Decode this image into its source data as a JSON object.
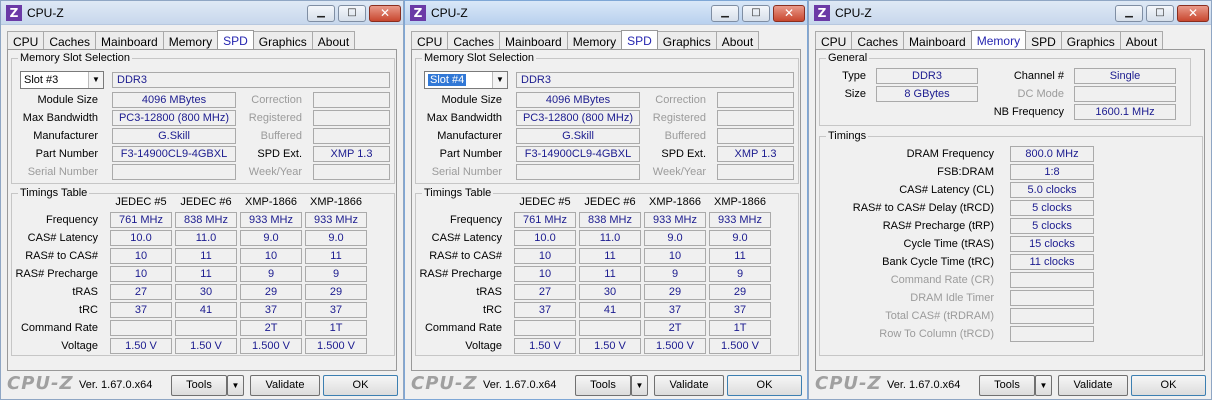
{
  "app": {
    "title": "CPU-Z",
    "icon": "Z"
  },
  "tabs": [
    "CPU",
    "Caches",
    "Mainboard",
    "Memory",
    "SPD",
    "Graphics",
    "About"
  ],
  "footer": {
    "logo": "CPU-Z",
    "version": "Ver. 1.67.0.x64",
    "tools": "Tools",
    "tools_arrow": "▼",
    "validate": "Validate",
    "ok": "OK"
  },
  "spd_labels": {
    "group_slot": "Memory Slot Selection",
    "module_size": "Module Size",
    "max_bandwidth": "Max Bandwidth",
    "manufacturer": "Manufacturer",
    "part_number": "Part Number",
    "serial_number": "Serial Number",
    "correction": "Correction",
    "registered": "Registered",
    "buffered": "Buffered",
    "spd_ext": "SPD Ext.",
    "week_year": "Week/Year",
    "group_timings": "Timings Table",
    "rows": [
      "Frequency",
      "CAS# Latency",
      "RAS# to CAS#",
      "RAS# Precharge",
      "tRAS",
      "tRC",
      "Command Rate",
      "Voltage"
    ],
    "cols": [
      "JEDEC #5",
      "JEDEC #6",
      "XMP-1866",
      "XMP-1866"
    ]
  },
  "window1": {
    "slot": "Slot #3",
    "type": "DDR3",
    "module_size": "4096 MBytes",
    "max_bandwidth": "PC3-12800 (800 MHz)",
    "manufacturer": "G.Skill",
    "part_number": "F3-14900CL9-4GBXL",
    "spd_ext": "XMP 1.3",
    "table": [
      [
        "761 MHz",
        "838 MHz",
        "933 MHz",
        "933 MHz"
      ],
      [
        "10.0",
        "11.0",
        "9.0",
        "9.0"
      ],
      [
        "10",
        "11",
        "10",
        "11"
      ],
      [
        "10",
        "11",
        "9",
        "9"
      ],
      [
        "27",
        "30",
        "29",
        "29"
      ],
      [
        "37",
        "41",
        "37",
        "37"
      ],
      [
        "",
        "",
        "2T",
        "1T"
      ],
      [
        "1.50 V",
        "1.50 V",
        "1.500 V",
        "1.500 V"
      ]
    ]
  },
  "window2": {
    "slot": "Slot #4",
    "type": "DDR3",
    "module_size": "4096 MBytes",
    "max_bandwidth": "PC3-12800 (800 MHz)",
    "manufacturer": "G.Skill",
    "part_number": "F3-14900CL9-4GBXL",
    "spd_ext": "XMP 1.3",
    "table": [
      [
        "761 MHz",
        "838 MHz",
        "933 MHz",
        "933 MHz"
      ],
      [
        "10.0",
        "11.0",
        "9.0",
        "9.0"
      ],
      [
        "10",
        "11",
        "10",
        "11"
      ],
      [
        "10",
        "11",
        "9",
        "9"
      ],
      [
        "27",
        "30",
        "29",
        "29"
      ],
      [
        "37",
        "41",
        "37",
        "37"
      ],
      [
        "",
        "",
        "2T",
        "1T"
      ],
      [
        "1.50 V",
        "1.50 V",
        "1.500 V",
        "1.500 V"
      ]
    ]
  },
  "window3": {
    "general": {
      "legend": "General",
      "type_label": "Type",
      "type": "DDR3",
      "size_label": "Size",
      "size": "8 GBytes",
      "channel_label": "Channel #",
      "channel": "Single",
      "dc_mode_label": "DC Mode",
      "dc_mode": "",
      "nb_freq_label": "NB Frequency",
      "nb_freq": "1600.1 MHz"
    },
    "timings": {
      "legend": "Timings",
      "rows": [
        {
          "label": "DRAM Frequency",
          "value": "800.0 MHz",
          "disabled": false
        },
        {
          "label": "FSB:DRAM",
          "value": "1:8",
          "disabled": false
        },
        {
          "label": "CAS# Latency (CL)",
          "value": "5.0 clocks",
          "disabled": false
        },
        {
          "label": "RAS# to CAS# Delay (tRCD)",
          "value": "5 clocks",
          "disabled": false
        },
        {
          "label": "RAS# Precharge (tRP)",
          "value": "5 clocks",
          "disabled": false
        },
        {
          "label": "Cycle Time (tRAS)",
          "value": "15 clocks",
          "disabled": false
        },
        {
          "label": "Bank Cycle Time (tRC)",
          "value": "11 clocks",
          "disabled": false
        },
        {
          "label": "Command Rate (CR)",
          "value": "",
          "disabled": true
        },
        {
          "label": "DRAM Idle Timer",
          "value": "",
          "disabled": true
        },
        {
          "label": "Total CAS# (tRDRAM)",
          "value": "",
          "disabled": true
        },
        {
          "label": "Row To Column (tRCD)",
          "value": "",
          "disabled": true
        }
      ]
    }
  }
}
